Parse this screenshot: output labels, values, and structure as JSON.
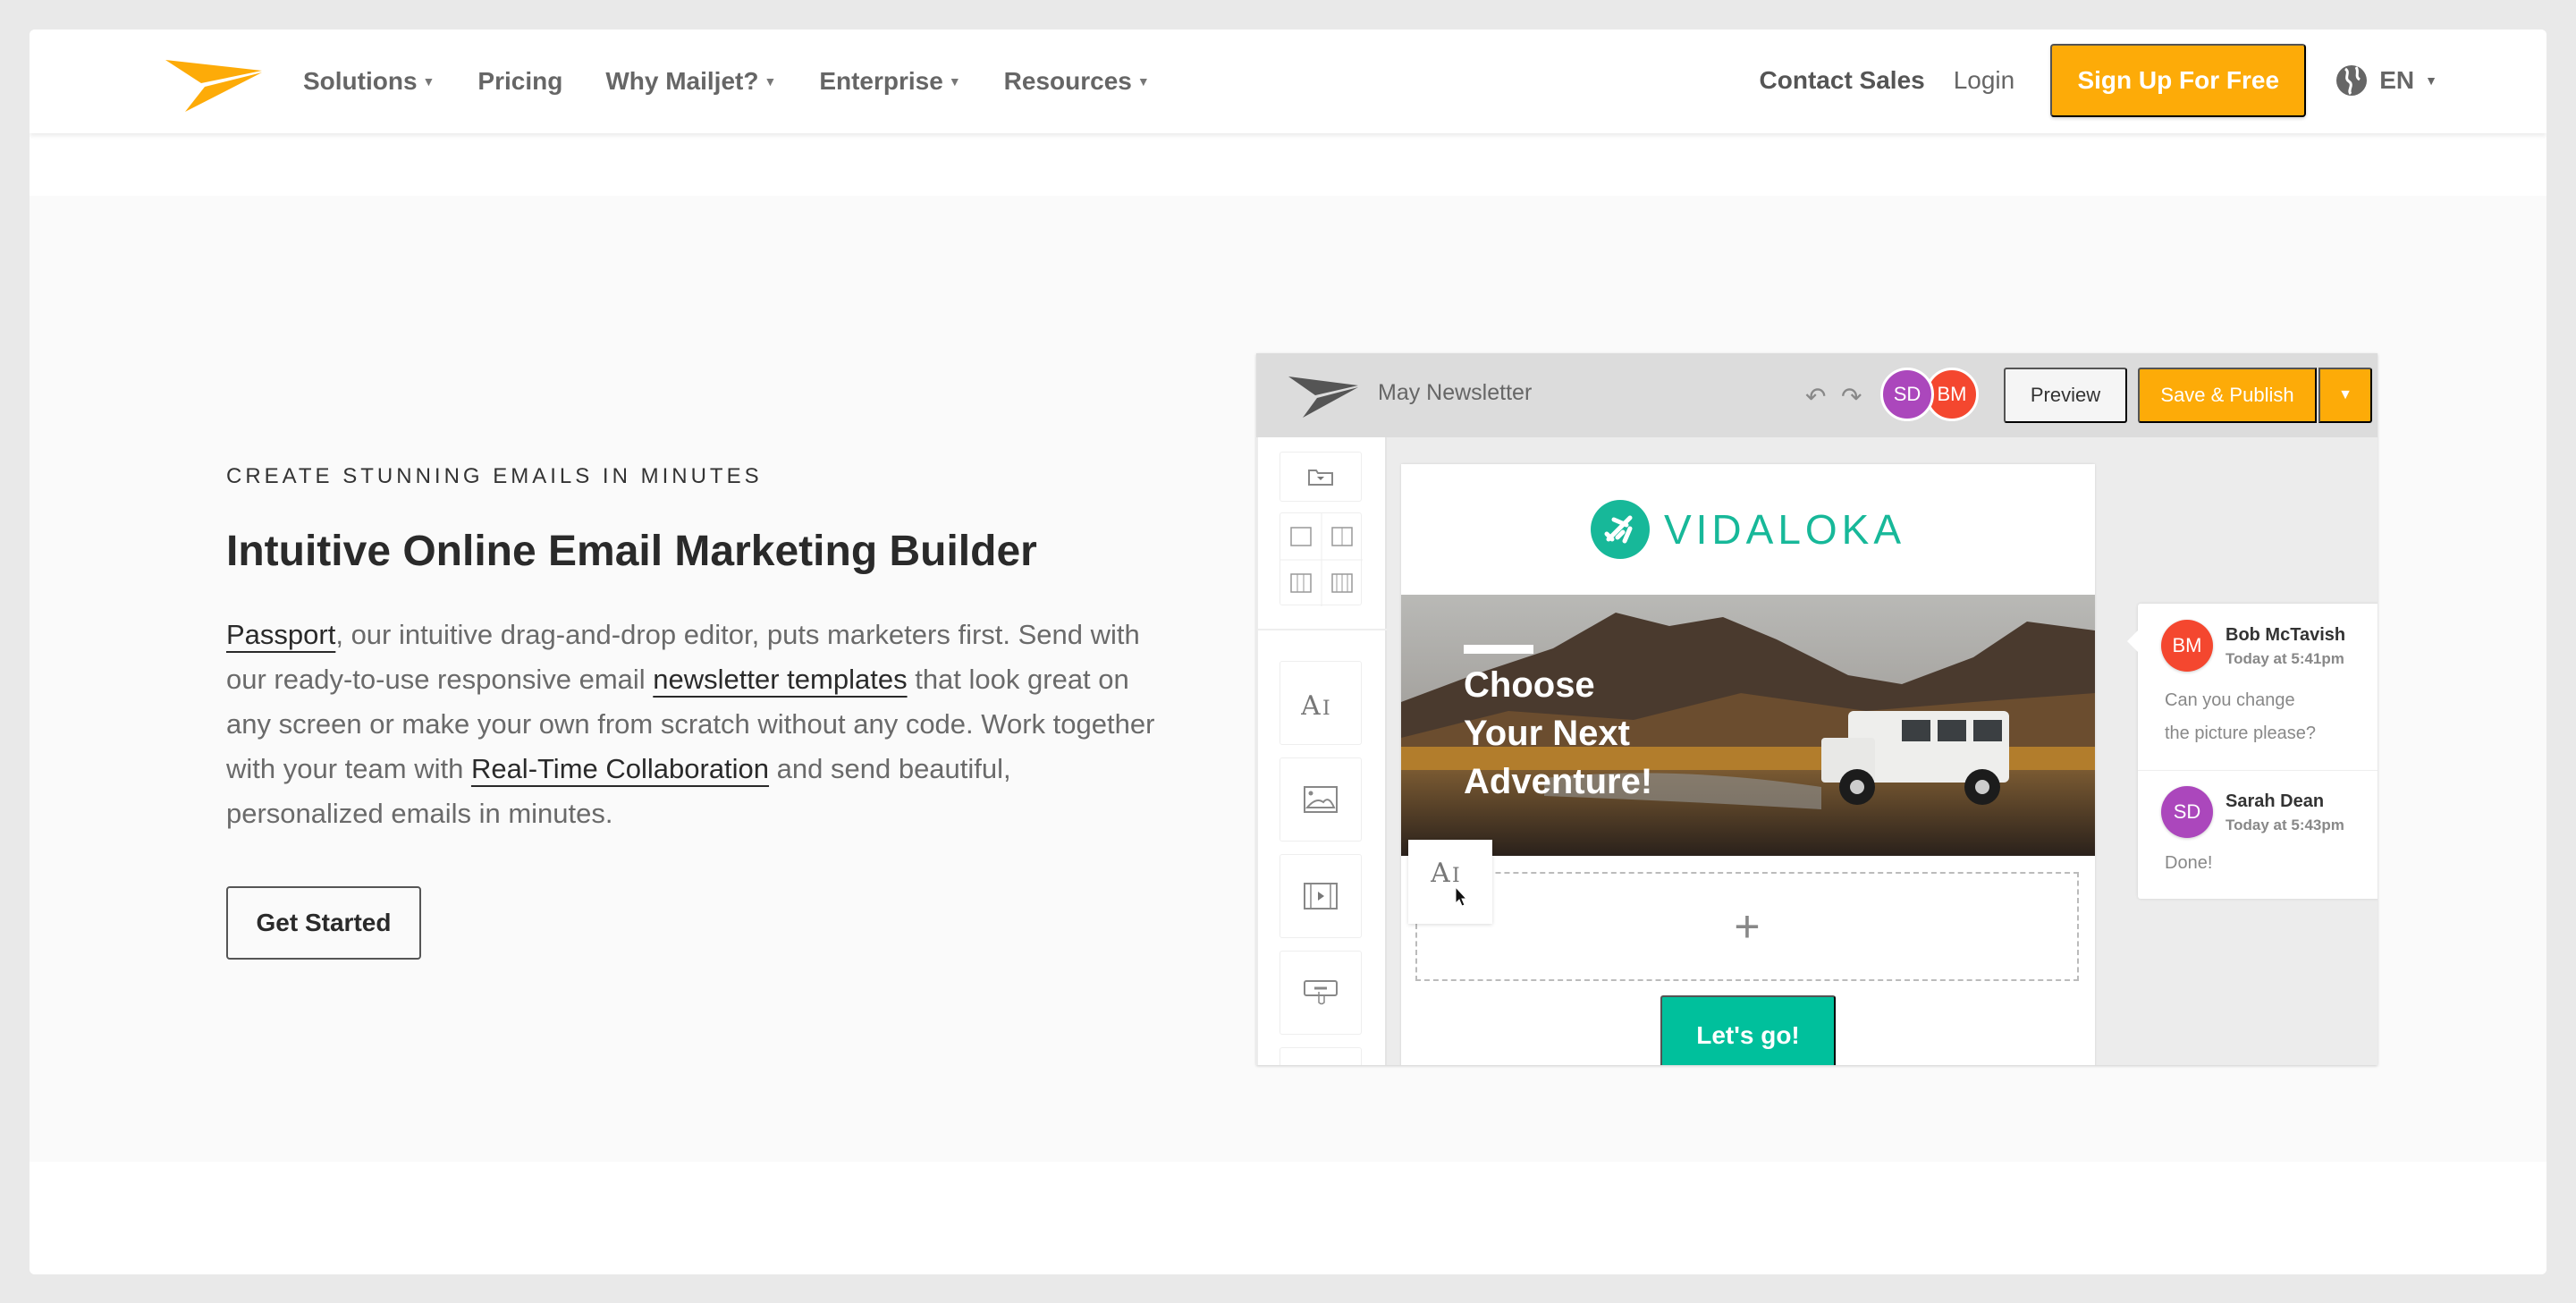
{
  "nav": {
    "menu": [
      {
        "label": "Solutions",
        "has_dropdown": true
      },
      {
        "label": "Pricing",
        "has_dropdown": false
      },
      {
        "label": "Why Mailjet?",
        "has_dropdown": true
      },
      {
        "label": "Enterprise",
        "has_dropdown": true
      },
      {
        "label": "Resources",
        "has_dropdown": true
      }
    ],
    "contact_sales": "Contact Sales",
    "login": "Login",
    "signup": "Sign Up For Free",
    "language": "EN",
    "caret": "▼",
    "brand_color": "#fdab08"
  },
  "hero": {
    "eyebrow": "CREATE STUNNING EMAILS IN MINUTES",
    "headline": "Intuitive Online Email Marketing Builder",
    "body": {
      "link1": "Passport",
      "text1": ", our intuitive drag-and-drop editor, puts marketers first. Send with our ready-to-use responsive email ",
      "link2": "newsletter templates",
      "text2": " that look great on any screen or make your own from scratch without any code. Work together with your team with ",
      "link3": "Real-Time Collaboration",
      "text3": " and send beautiful, personalized emails in minutes."
    },
    "cta": "Get Started"
  },
  "editor": {
    "title": "May Newsletter",
    "undo_icon": "↶",
    "redo_icon": "↷",
    "collaborators": [
      {
        "initials": "SD",
        "color": "#ab47bc"
      },
      {
        "initials": "BM",
        "color": "#f4472f"
      }
    ],
    "preview": "Preview",
    "publish": "Save & Publish",
    "publish_caret": "▼",
    "email": {
      "brand": "VIDALOKA",
      "brand_color": "#17b899",
      "banner_lines": [
        "Choose",
        "Your Next",
        "Adventure!"
      ],
      "dropzone_icon": "+",
      "cta": "Let's go!",
      "cta_color": "#00c09c"
    },
    "comments": [
      {
        "initials": "BM",
        "color": "#f4472f",
        "name": "Bob McTavish",
        "time": "Today at 5:41pm",
        "lines": [
          "Can you change",
          "the picture please?"
        ]
      },
      {
        "initials": "SD",
        "color": "#ab47bc",
        "name": "Sarah Dean",
        "time": "Today at 5:43pm",
        "lines": [
          "Done!"
        ]
      }
    ]
  }
}
